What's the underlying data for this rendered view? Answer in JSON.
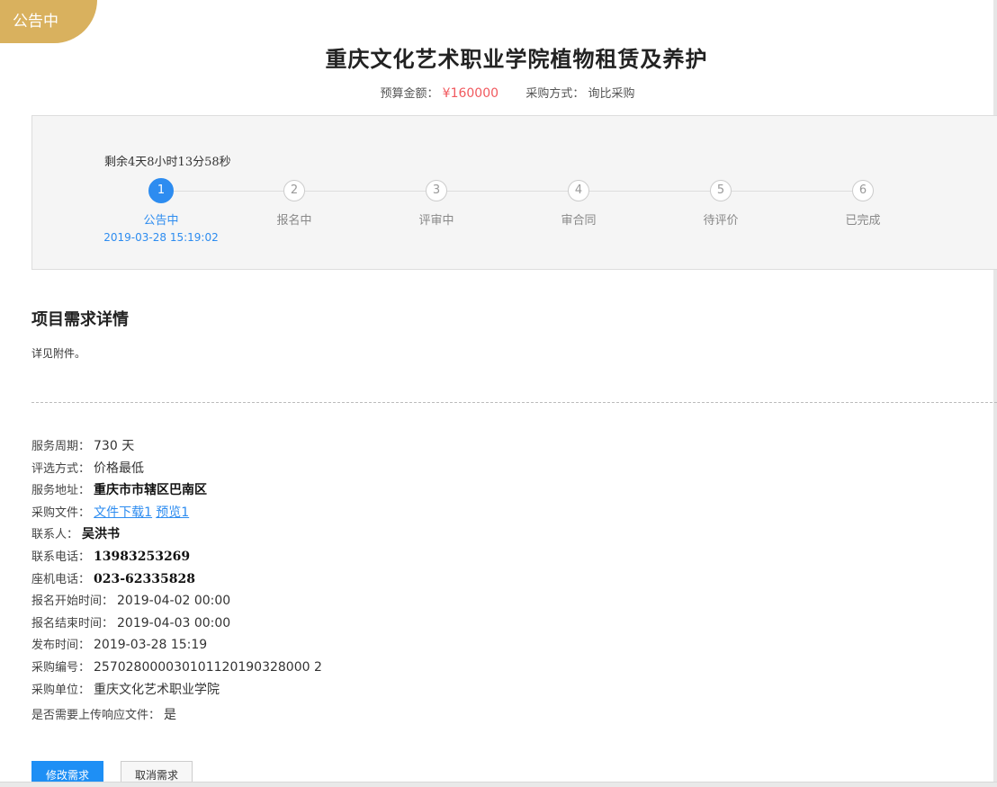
{
  "status_badge": "公告中",
  "title": "重庆文化艺术职业学院植物租赁及养护",
  "budget": {
    "label": "预算金额：",
    "value": "¥160000"
  },
  "purchase_method": {
    "label": "采购方式：",
    "value": "询比采购"
  },
  "progress": {
    "remaining": "剩余4天8小时13分58秒",
    "steps": [
      {
        "num": "1",
        "label": "公告中",
        "date": "2019-03-28 15:19:02",
        "active": true
      },
      {
        "num": "2",
        "label": "报名中"
      },
      {
        "num": "3",
        "label": "评审中"
      },
      {
        "num": "4",
        "label": "审合同"
      },
      {
        "num": "5",
        "label": "待评价"
      },
      {
        "num": "6",
        "label": "已完成"
      }
    ]
  },
  "section": {
    "title": "项目需求详情",
    "desc": "详见附件。"
  },
  "details": {
    "service_period": {
      "label": "服务周期：",
      "value": "730 天"
    },
    "selection": {
      "label": "评选方式：",
      "value": "价格最低"
    },
    "address": {
      "label": "服务地址：",
      "value": "重庆市市辖区巴南区"
    },
    "files": {
      "label": "采购文件：",
      "download": "文件下载1",
      "preview": "预览1"
    },
    "contact": {
      "label": "联系人：",
      "value": "吴洪书"
    },
    "phone": {
      "label": "联系电话：",
      "value": "13983253269"
    },
    "landline": {
      "label": "座机电话：",
      "value": "023-62335828"
    },
    "reg_start": {
      "label": "报名开始时间：",
      "value": "2019-04-02 00:00"
    },
    "reg_end": {
      "label": "报名结束时间：",
      "value": "2019-04-03 00:00"
    },
    "publish_time": {
      "label": "发布时间：",
      "value": "2019-03-28 15:19"
    },
    "purchase_no": {
      "label": "采购编号：",
      "value": "257028000030101120190328000 2"
    },
    "purchaser": {
      "label": "采购单位：",
      "value": "重庆文化艺术职业学院"
    },
    "upload_required": {
      "label": "是否需要上传响应文件：",
      "value": "是"
    }
  },
  "buttons": {
    "modify": "修改需求",
    "cancel": "取消需求"
  },
  "colors": {
    "accent": "#2d8cf0",
    "badge": "#d9b15e",
    "money": "#f1595e"
  }
}
